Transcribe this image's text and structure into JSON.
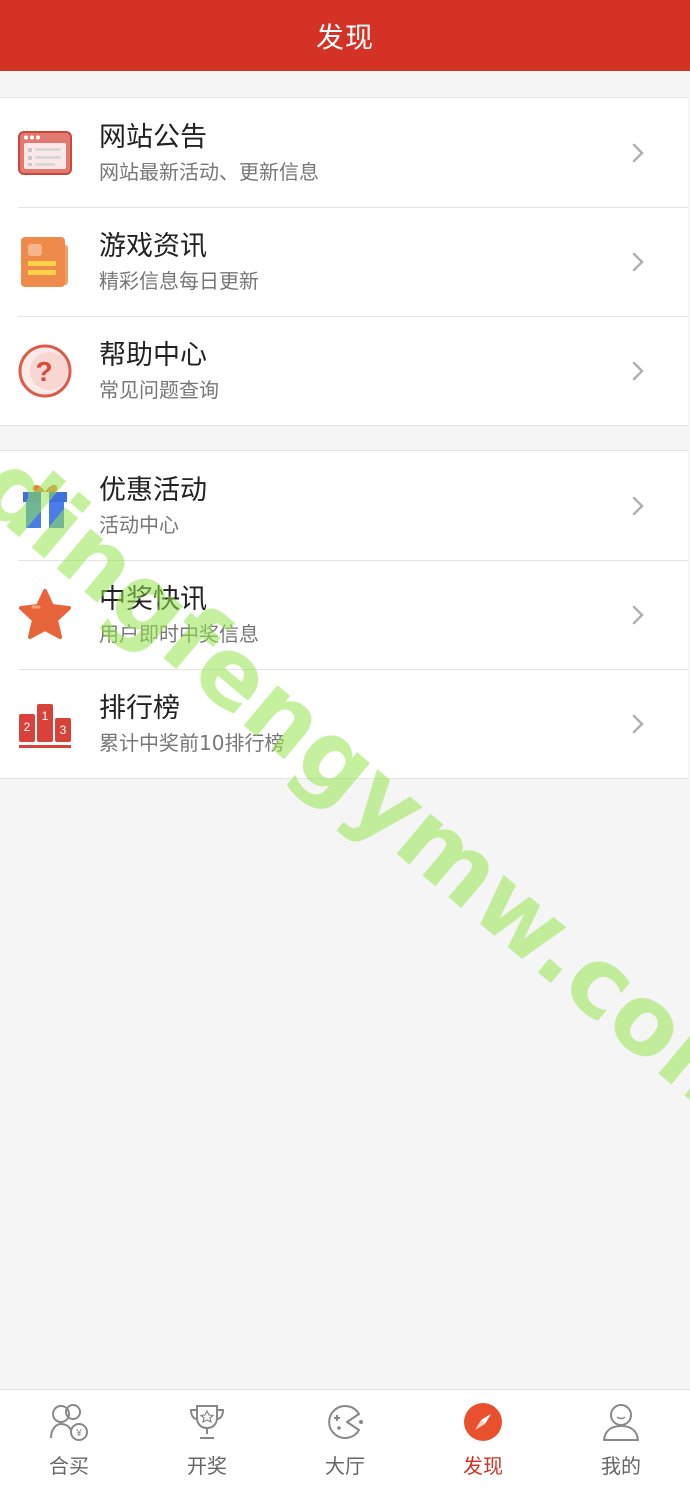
{
  "header": {
    "title": "发现"
  },
  "menu_group_1": [
    {
      "title": "网站公告",
      "subtitle": "网站最新活动、更新信息",
      "icon": "announcement-window-icon"
    },
    {
      "title": "游戏资讯",
      "subtitle": "精彩信息每日更新",
      "icon": "news-notebook-icon"
    },
    {
      "title": "帮助中心",
      "subtitle": "常见问题查询",
      "icon": "help-question-icon"
    }
  ],
  "menu_group_2": [
    {
      "title": "优惠活动",
      "subtitle": "活动中心",
      "icon": "gift-icon"
    },
    {
      "title": "中奖快讯",
      "subtitle": "用户即时中奖信息",
      "icon": "star-icon"
    },
    {
      "title": "排行榜",
      "subtitle": "累计中奖前10排行榜",
      "icon": "podium-icon"
    }
  ],
  "podium_digits": [
    "2",
    "1",
    "3"
  ],
  "tabbar": [
    {
      "label": "合买",
      "icon": "group-buy-icon",
      "active": false
    },
    {
      "label": "开奖",
      "icon": "trophy-icon",
      "active": false
    },
    {
      "label": "大厅",
      "icon": "game-hall-icon",
      "active": false
    },
    {
      "label": "发现",
      "icon": "compass-icon",
      "active": true
    },
    {
      "label": "我的",
      "icon": "profile-icon",
      "active": false
    }
  ],
  "watermark": "dingfengymw.com",
  "colors": {
    "brand_red": "#d43224",
    "active_tab": "#d43224",
    "gift_blue": "#4a7de8",
    "star_orange": "#e8643a"
  }
}
